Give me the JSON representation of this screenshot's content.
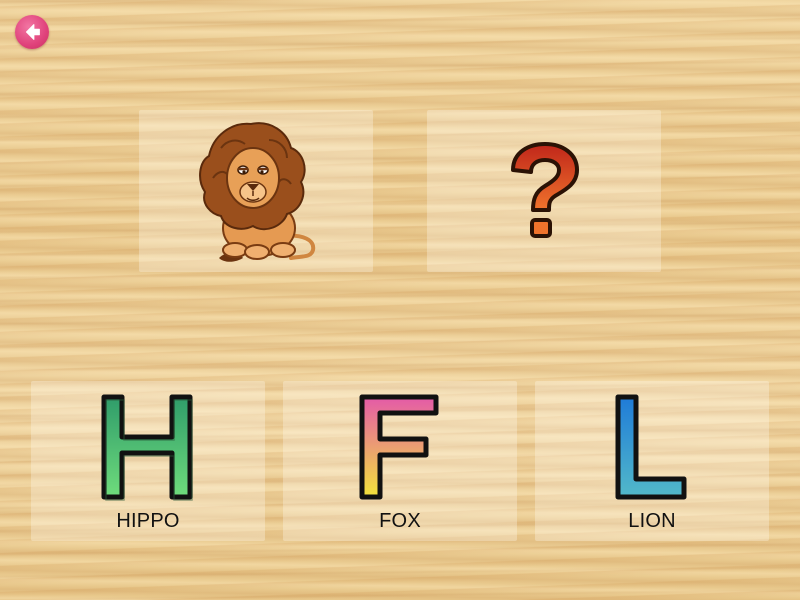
{
  "icons": {
    "back": "left-arrow-icon",
    "prompt_image": "lion-icon",
    "mystery": "question-mark-icon"
  },
  "choices": [
    {
      "letter": "H",
      "word": "HIPPO",
      "gradient": [
        "#2f9c6a",
        "#6fdc7c"
      ]
    },
    {
      "letter": "F",
      "word": "FOX",
      "gradient": [
        "#e45aa8",
        "#f2e33b"
      ]
    },
    {
      "letter": "L",
      "word": "LION",
      "gradient": [
        "#1f7bd8",
        "#52b9c9"
      ]
    }
  ],
  "colors": {
    "back_button": "#e0427b",
    "question_mark": "#d6411c",
    "label_text": "#111111"
  }
}
